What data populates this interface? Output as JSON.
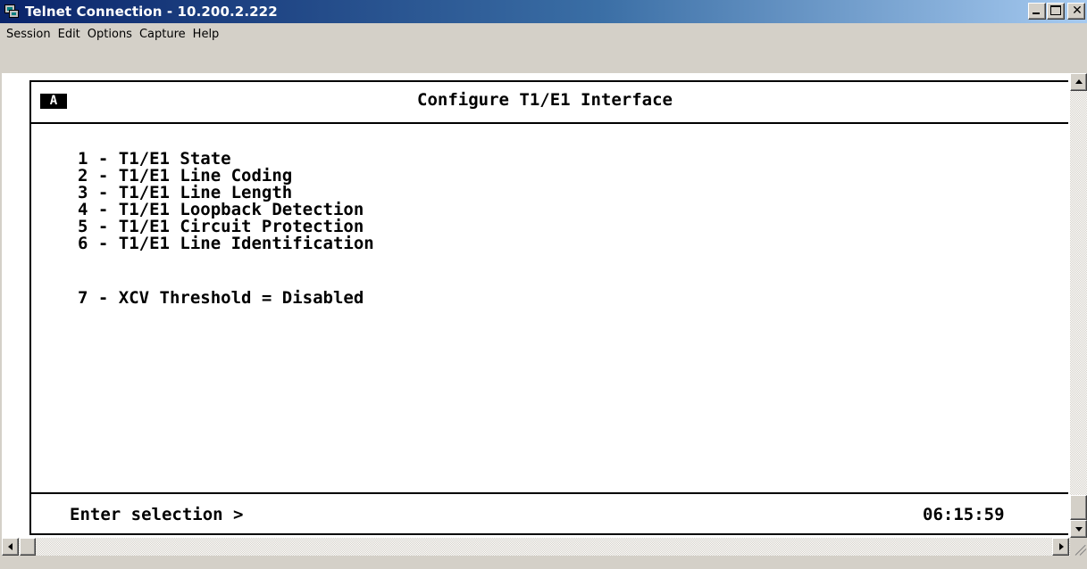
{
  "window": {
    "title": "Telnet Connection - 10.200.2.222",
    "app_icon": "telnet-computers-icon",
    "controls": {
      "minimize_icon": "minimize-icon",
      "maximize_icon": "maximize-icon",
      "close_glyph": "✕"
    }
  },
  "menubar": {
    "items": [
      "Session",
      "Edit",
      "Options",
      "Capture",
      "Help"
    ]
  },
  "terminal": {
    "screen_id": "A",
    "title": "Configure T1/E1 Interface",
    "menu": [
      "1 - T1/E1 State",
      "2 - T1/E1 Line Coding",
      "3 - T1/E1 Line Length",
      "4 - T1/E1 Loopback Detection",
      "5 - T1/E1 Circuit Protection",
      "6 - T1/E1 Line Identification"
    ],
    "extra_option": "7 - XCV Threshold = Disabled",
    "prompt": "Enter selection >",
    "clock": "06:15:59"
  },
  "colors": {
    "titlebar_start": "#0a246a",
    "titlebar_end": "#a6caf0",
    "terminal_bg": "#ffffff",
    "terminal_fg": "#000000",
    "chrome": "#d4d0c8"
  }
}
